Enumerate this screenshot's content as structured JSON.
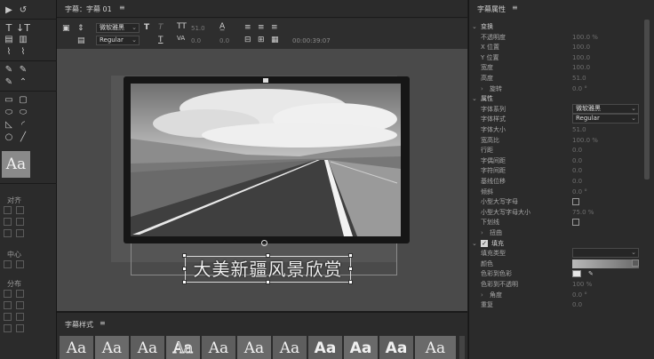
{
  "title_panel": {
    "title": "字幕：字幕 01",
    "font_family": "微软雅黑",
    "font_style": "Regular",
    "font_size": "51.0",
    "kerning": "0.0",
    "leading": "0.0",
    "timecode": "00:00:39:07",
    "caption_text": "大美新疆风景欣赏"
  },
  "left_tools": {
    "aa_label": "Aa",
    "align_label": "对齐",
    "center_label": "中心",
    "distribute_label": "分布"
  },
  "styles_panel": {
    "title": "字幕样式",
    "swatches": [
      "Aa",
      "Aa",
      "Aa",
      "Aa",
      "Aa",
      "Aa",
      "Aa",
      "Aa",
      "Aa",
      "Aa",
      "Aa"
    ]
  },
  "properties": {
    "title": "字幕属性",
    "rows": [
      {
        "label": "变换",
        "kind": "section"
      },
      {
        "label": "不透明度",
        "value": "100.0 %"
      },
      {
        "label": "X 位置",
        "value": "100.0"
      },
      {
        "label": "Y 位置",
        "value": "100.0"
      },
      {
        "label": "宽度",
        "value": "100.0"
      },
      {
        "label": "高度",
        "value": "51.0"
      },
      {
        "label": "旋转",
        "value": "0.0 °",
        "kind": "sub"
      },
      {
        "label": "属性",
        "kind": "section"
      },
      {
        "label": "字体系列",
        "value": "微软雅黑",
        "kind": "dropdown"
      },
      {
        "label": "字体样式",
        "value": "Regular",
        "kind": "dropdown"
      },
      {
        "label": "字体大小",
        "value": "51.0"
      },
      {
        "label": "宽高比",
        "value": "100.0 %"
      },
      {
        "label": "行距",
        "value": "0.0"
      },
      {
        "label": "字偶间距",
        "value": "0.0"
      },
      {
        "label": "字符间距",
        "value": "0.0"
      },
      {
        "label": "基线位移",
        "value": "0.0"
      },
      {
        "label": "倾斜",
        "value": "0.0 °"
      },
      {
        "label": "小型大写字母",
        "kind": "checkbox"
      },
      {
        "label": "小型大写字母大小",
        "value": "75.0 %"
      },
      {
        "label": "下划线",
        "kind": "checkbox"
      },
      {
        "label": "扭曲",
        "kind": "sub"
      },
      {
        "label": "填充",
        "kind": "section-check"
      },
      {
        "label": "填充类型",
        "kind": "dropdown",
        "value": ""
      },
      {
        "label": "颜色",
        "kind": "gradient"
      },
      {
        "label": "色彩到色彩",
        "kind": "swatch-row"
      },
      {
        "label": "色彩到不透明",
        "value": "100 %"
      },
      {
        "label": "角度",
        "value": "0.0 °",
        "kind": "sub"
      },
      {
        "label": "重复",
        "value": "0.0"
      }
    ]
  }
}
